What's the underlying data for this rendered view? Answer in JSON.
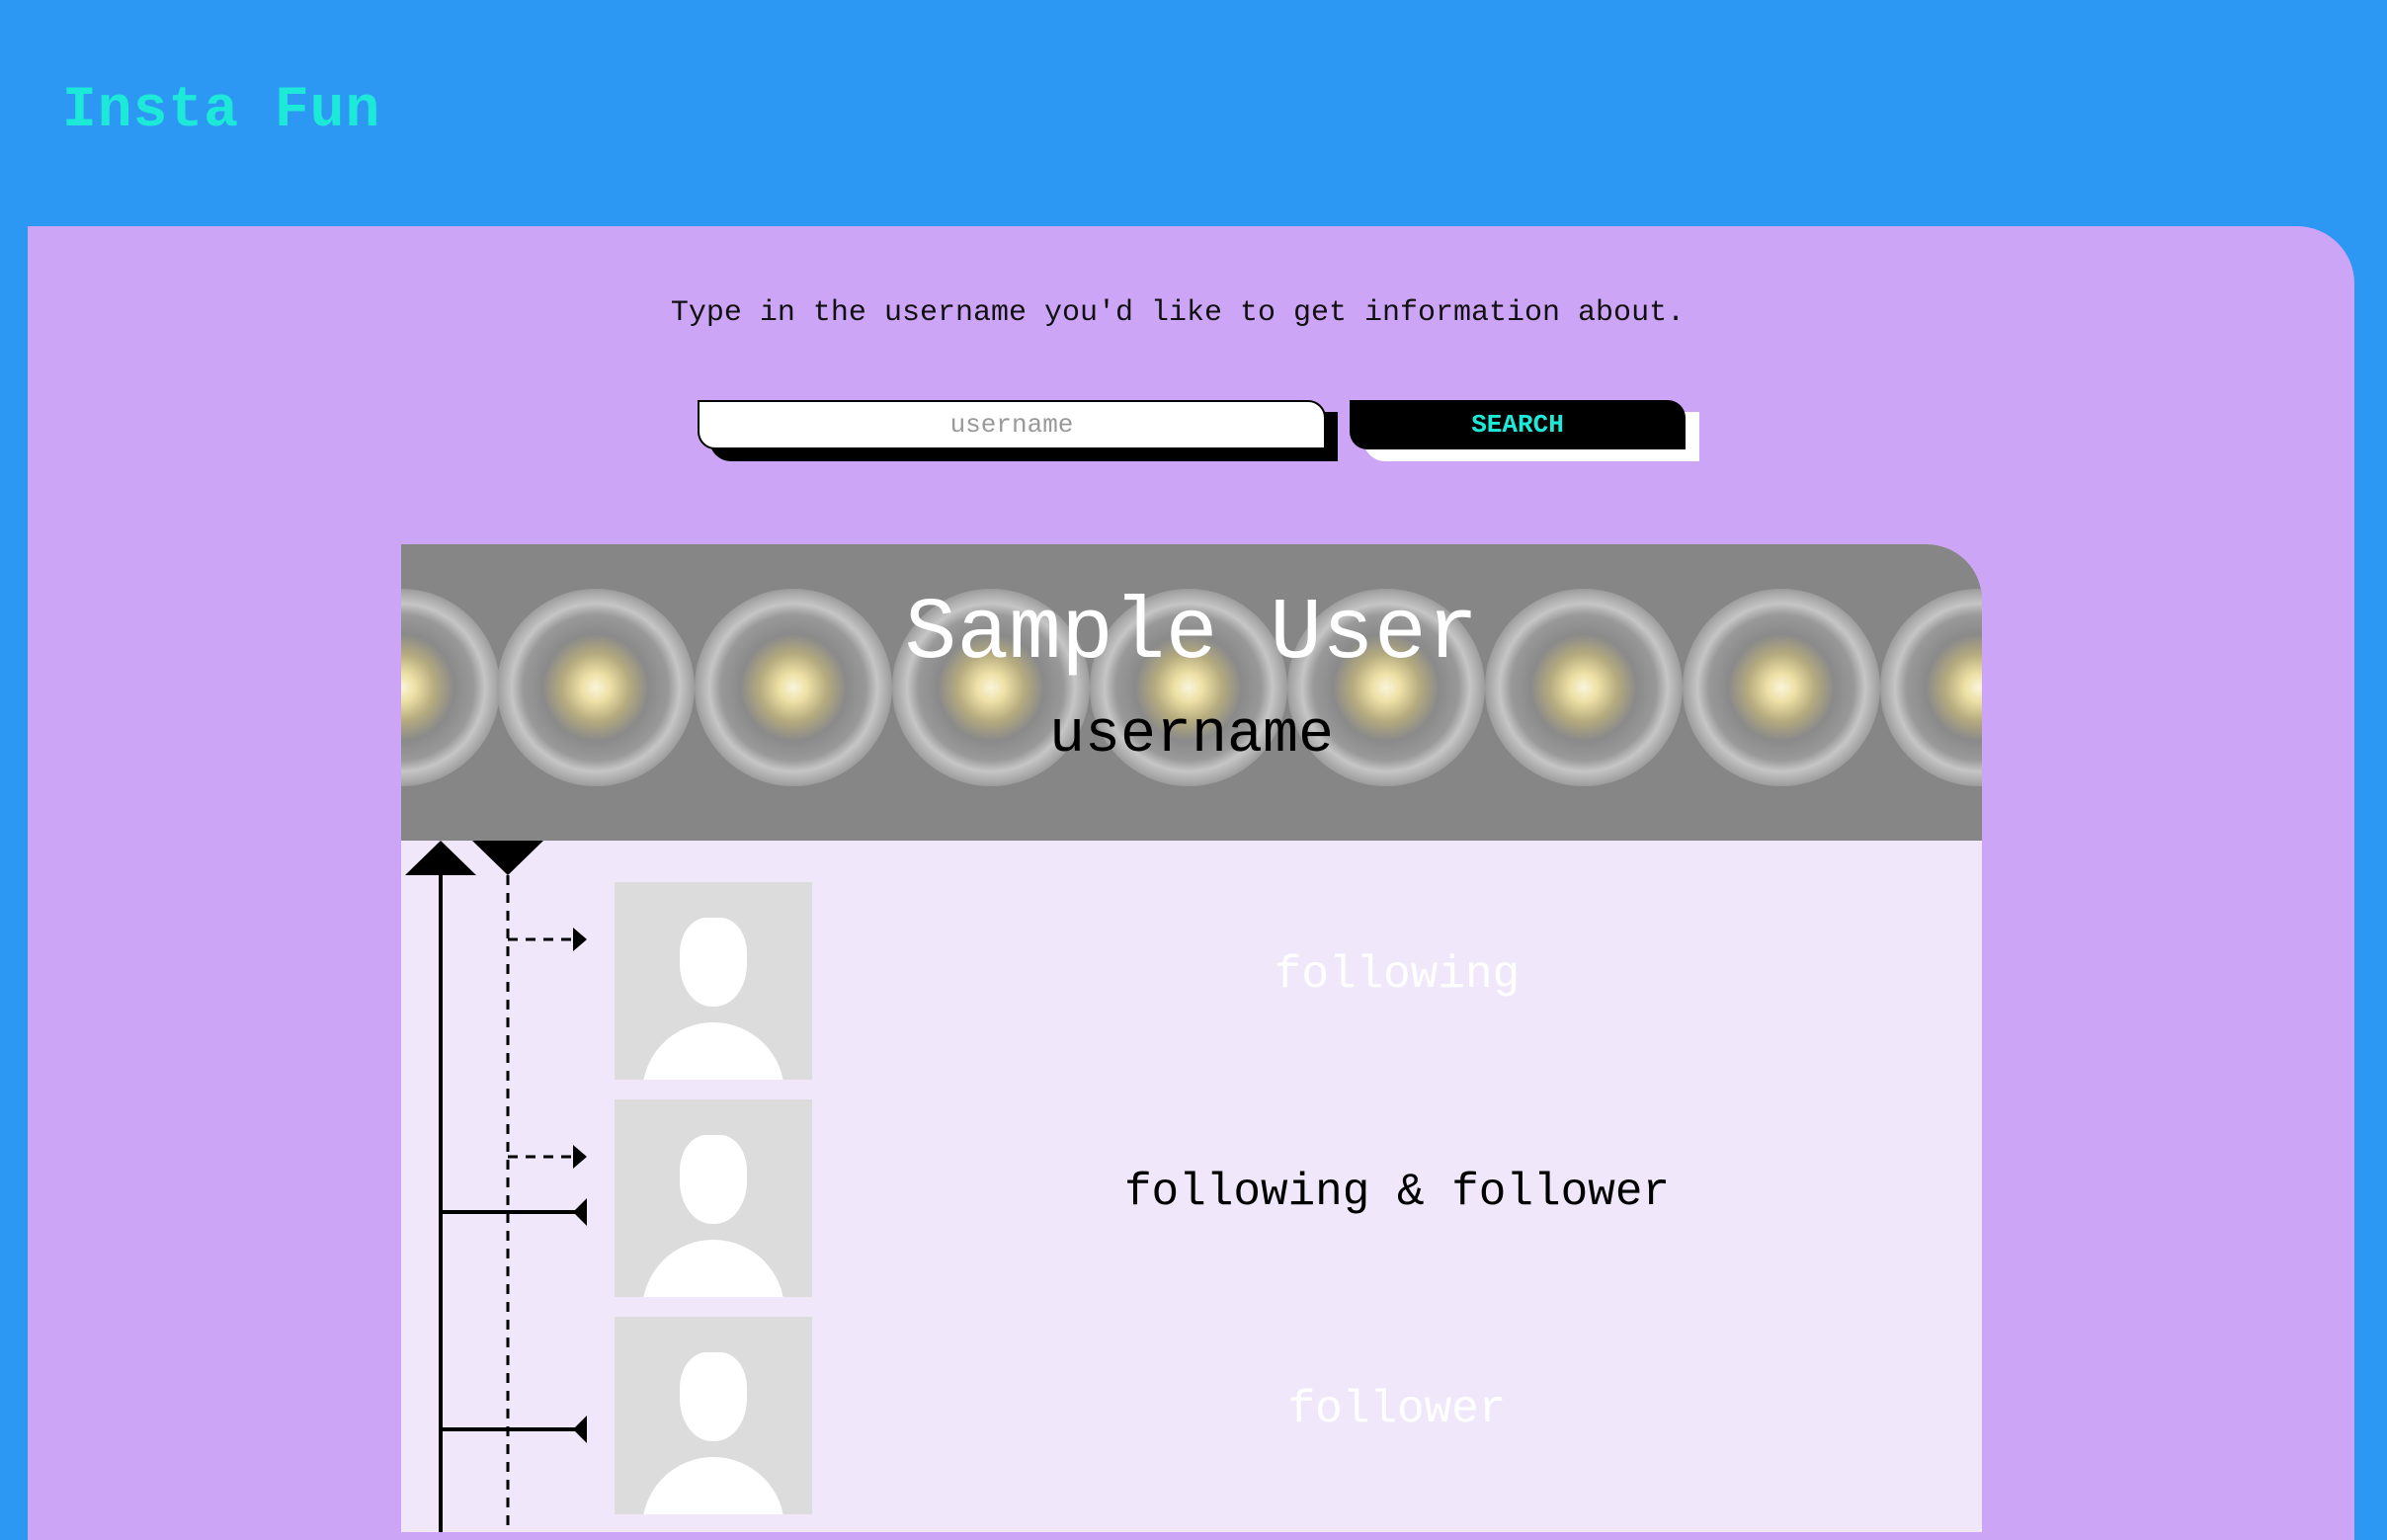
{
  "header": {
    "brand": "Insta Fun"
  },
  "search": {
    "prompt": "Type in the username you'd like to get information about.",
    "placeholder": "username",
    "value": "",
    "button_label": "SEARCH"
  },
  "profile": {
    "display_name": "Sample User",
    "username": "username"
  },
  "rows": [
    {
      "label": "following",
      "label_color": "#ffffff"
    },
    {
      "label": "following & follower",
      "label_color": "#000000"
    },
    {
      "label": "follower",
      "label_color": "#ffffff"
    }
  ],
  "colors": {
    "page_bg": "#2d98f3",
    "brand": "#1de9d8",
    "panel": "#cda5f7",
    "card": "#f1e7fa",
    "banner": "#868686"
  },
  "icons": [
    "arrow-up-icon",
    "arrow-down-icon",
    "user-placeholder-icon"
  ]
}
